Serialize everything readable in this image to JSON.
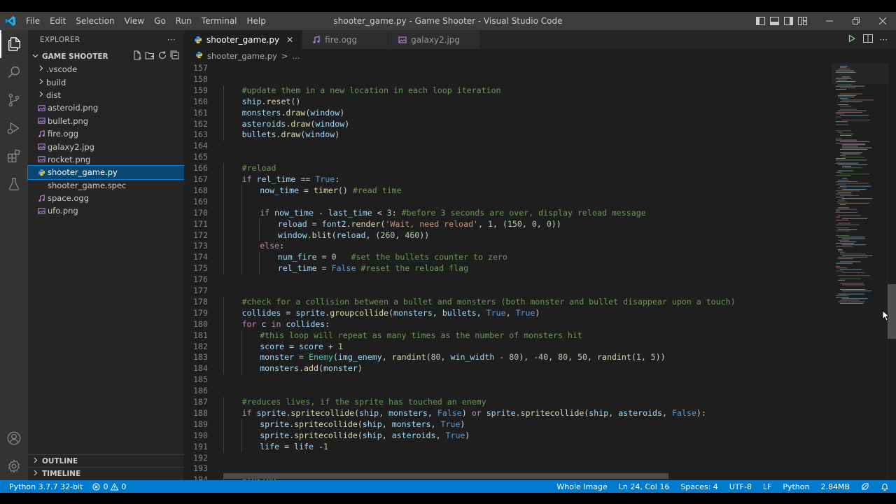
{
  "window": {
    "title": "shooter_game.py - Game Shooter - Visual Studio Code",
    "menu": [
      "File",
      "Edit",
      "Selection",
      "View",
      "Go",
      "Run",
      "Terminal",
      "Help"
    ]
  },
  "sidebar": {
    "header": "EXPLORER",
    "more": "···",
    "folder": "GAME SHOOTER",
    "items": [
      {
        "label": ".vscode",
        "type": "folder"
      },
      {
        "label": "build",
        "type": "folder"
      },
      {
        "label": "dist",
        "type": "folder"
      },
      {
        "label": "asteroid.png",
        "type": "image"
      },
      {
        "label": "bullet.png",
        "type": "image"
      },
      {
        "label": "fire.ogg",
        "type": "audio"
      },
      {
        "label": "galaxy2.jpg",
        "type": "image"
      },
      {
        "label": "rocket.png",
        "type": "image"
      },
      {
        "label": "shooter_game.py",
        "type": "python",
        "selected": true
      },
      {
        "label": "shooter_game.spec",
        "type": "spec"
      },
      {
        "label": "space.ogg",
        "type": "audio"
      },
      {
        "label": "ufo.png",
        "type": "image"
      }
    ],
    "outline": "OUTLINE",
    "timeline": "TIMELINE"
  },
  "tabs": [
    {
      "label": "shooter_game.py",
      "active": true,
      "type": "python"
    },
    {
      "label": "fire.ogg",
      "active": false,
      "type": "audio"
    },
    {
      "label": "galaxy2.jpg",
      "active": false,
      "type": "image"
    }
  ],
  "breadcrumb": {
    "file": "shooter_game.py",
    "sep": ">",
    "rest": "..."
  },
  "code": {
    "lines": [
      {
        "n": "157",
        "indent": 0,
        "tokens": []
      },
      {
        "n": "158",
        "indent": 0,
        "tokens": []
      },
      {
        "n": "159",
        "indent": 1,
        "tokens": [
          [
            "c-com",
            "#update them in a new location in each loop iteration"
          ]
        ]
      },
      {
        "n": "160",
        "indent": 1,
        "tokens": [
          [
            "c-var",
            "ship"
          ],
          [
            "",
            "."
          ],
          [
            "c-fn",
            "reset"
          ],
          [
            "",
            "()"
          ]
        ]
      },
      {
        "n": "161",
        "indent": 1,
        "tokens": [
          [
            "c-var",
            "monsters"
          ],
          [
            "",
            "."
          ],
          [
            "c-fn",
            "draw"
          ],
          [
            "",
            "("
          ],
          [
            "c-var",
            "window"
          ],
          [
            "",
            ")"
          ]
        ]
      },
      {
        "n": "162",
        "indent": 1,
        "tokens": [
          [
            "c-var",
            "asteroids"
          ],
          [
            "",
            "."
          ],
          [
            "c-fn",
            "draw"
          ],
          [
            "",
            "("
          ],
          [
            "c-var",
            "window"
          ],
          [
            "",
            ")"
          ]
        ]
      },
      {
        "n": "163",
        "indent": 1,
        "tokens": [
          [
            "c-var",
            "bullets"
          ],
          [
            "",
            "."
          ],
          [
            "c-fn",
            "draw"
          ],
          [
            "",
            "("
          ],
          [
            "c-var",
            "window"
          ],
          [
            "",
            ")"
          ]
        ]
      },
      {
        "n": "164",
        "indent": 0,
        "tokens": []
      },
      {
        "n": "165",
        "indent": 0,
        "tokens": []
      },
      {
        "n": "166",
        "indent": 1,
        "tokens": [
          [
            "c-com",
            "#reload"
          ]
        ]
      },
      {
        "n": "167",
        "indent": 1,
        "tokens": [
          [
            "c-kw",
            "if"
          ],
          [
            "",
            " "
          ],
          [
            "c-var",
            "rel_time"
          ],
          [
            "",
            " == "
          ],
          [
            "c-bool",
            "True"
          ],
          [
            "",
            ":"
          ]
        ]
      },
      {
        "n": "168",
        "indent": 2,
        "tokens": [
          [
            "c-var",
            "now_time"
          ],
          [
            "",
            " = "
          ],
          [
            "c-fn",
            "timer"
          ],
          [
            "",
            "() "
          ],
          [
            "c-com",
            "#read time"
          ]
        ]
      },
      {
        "n": "169",
        "indent": 0,
        "tokens": []
      },
      {
        "n": "170",
        "indent": 2,
        "tokens": [
          [
            "c-kw",
            "if"
          ],
          [
            "",
            " "
          ],
          [
            "c-var",
            "now_time"
          ],
          [
            "",
            " - "
          ],
          [
            "c-var",
            "last_time"
          ],
          [
            "",
            " < "
          ],
          [
            "c-num",
            "3"
          ],
          [
            "",
            ": "
          ],
          [
            "c-com",
            "#before 3 seconds are over, display reload message"
          ]
        ]
      },
      {
        "n": "171",
        "indent": 3,
        "tokens": [
          [
            "c-var",
            "reload"
          ],
          [
            "",
            " = "
          ],
          [
            "c-var",
            "font2"
          ],
          [
            "",
            "."
          ],
          [
            "c-fn",
            "render"
          ],
          [
            "",
            "("
          ],
          [
            "c-str",
            "'Wait, need reload'"
          ],
          [
            "",
            ", "
          ],
          [
            "c-num",
            "1"
          ],
          [
            "",
            ", ("
          ],
          [
            "c-num",
            "150"
          ],
          [
            "",
            ", "
          ],
          [
            "c-num",
            "0"
          ],
          [
            "",
            ", "
          ],
          [
            "c-num",
            "0"
          ],
          [
            "",
            "))"
          ]
        ]
      },
      {
        "n": "172",
        "indent": 3,
        "tokens": [
          [
            "c-var",
            "window"
          ],
          [
            "",
            "."
          ],
          [
            "c-fn",
            "blit"
          ],
          [
            "",
            "("
          ],
          [
            "c-var",
            "reload"
          ],
          [
            "",
            ", ("
          ],
          [
            "c-num",
            "260"
          ],
          [
            "",
            ", "
          ],
          [
            "c-num",
            "460"
          ],
          [
            "",
            "))"
          ]
        ]
      },
      {
        "n": "173",
        "indent": 2,
        "tokens": [
          [
            "c-kw",
            "else"
          ],
          [
            "",
            ":"
          ]
        ]
      },
      {
        "n": "174",
        "indent": 3,
        "tokens": [
          [
            "c-var",
            "num_fire"
          ],
          [
            "",
            " = "
          ],
          [
            "c-num",
            "0"
          ],
          [
            "",
            "   "
          ],
          [
            "c-com",
            "#set the bullets counter to zero"
          ]
        ]
      },
      {
        "n": "175",
        "indent": 3,
        "tokens": [
          [
            "c-var",
            "rel_time"
          ],
          [
            "",
            " = "
          ],
          [
            "c-bool",
            "False"
          ],
          [
            "",
            " "
          ],
          [
            "c-com",
            "#reset the reload flag"
          ]
        ]
      },
      {
        "n": "176",
        "indent": 0,
        "tokens": []
      },
      {
        "n": "177",
        "indent": 0,
        "tokens": []
      },
      {
        "n": "178",
        "indent": 1,
        "tokens": [
          [
            "c-com",
            "#check for a collision between a bullet and monsters (both monster and bullet disappear upon a touch)"
          ]
        ]
      },
      {
        "n": "179",
        "indent": 1,
        "tokens": [
          [
            "c-var",
            "collides"
          ],
          [
            "",
            " = "
          ],
          [
            "c-var",
            "sprite"
          ],
          [
            "",
            "."
          ],
          [
            "c-fn",
            "groupcollide"
          ],
          [
            "",
            "("
          ],
          [
            "c-var",
            "monsters"
          ],
          [
            "",
            ", "
          ],
          [
            "c-var",
            "bullets"
          ],
          [
            "",
            ", "
          ],
          [
            "c-bool",
            "True"
          ],
          [
            "",
            ", "
          ],
          [
            "c-bool",
            "True"
          ],
          [
            "",
            ")"
          ]
        ]
      },
      {
        "n": "180",
        "indent": 1,
        "tokens": [
          [
            "c-kw",
            "for"
          ],
          [
            "",
            " "
          ],
          [
            "c-var",
            "c"
          ],
          [
            "",
            " "
          ],
          [
            "c-kw",
            "in"
          ],
          [
            "",
            " "
          ],
          [
            "c-var",
            "collides"
          ],
          [
            "",
            ":"
          ]
        ]
      },
      {
        "n": "181",
        "indent": 2,
        "tokens": [
          [
            "c-com",
            "#this loop will repeat as many times as the number of monsters hit"
          ]
        ]
      },
      {
        "n": "182",
        "indent": 2,
        "tokens": [
          [
            "c-var",
            "score"
          ],
          [
            "",
            " = "
          ],
          [
            "c-var",
            "score"
          ],
          [
            "",
            " + "
          ],
          [
            "c-num",
            "1"
          ]
        ]
      },
      {
        "n": "183",
        "indent": 2,
        "tokens": [
          [
            "c-var",
            "monster"
          ],
          [
            "",
            " = "
          ],
          [
            "c-cls",
            "Enemy"
          ],
          [
            "",
            "("
          ],
          [
            "c-var",
            "img_enemy"
          ],
          [
            "",
            ", "
          ],
          [
            "c-fn",
            "randint"
          ],
          [
            "",
            "("
          ],
          [
            "c-num",
            "80"
          ],
          [
            "",
            ", "
          ],
          [
            "c-var",
            "win_width"
          ],
          [
            "",
            " - "
          ],
          [
            "c-num",
            "80"
          ],
          [
            "",
            "), -"
          ],
          [
            "c-num",
            "40"
          ],
          [
            "",
            ", "
          ],
          [
            "c-num",
            "80"
          ],
          [
            "",
            ", "
          ],
          [
            "c-num",
            "50"
          ],
          [
            "",
            ", "
          ],
          [
            "c-fn",
            "randint"
          ],
          [
            "",
            "("
          ],
          [
            "c-num",
            "1"
          ],
          [
            "",
            ", "
          ],
          [
            "c-num",
            "5"
          ],
          [
            "",
            "))"
          ]
        ]
      },
      {
        "n": "184",
        "indent": 2,
        "tokens": [
          [
            "c-var",
            "monsters"
          ],
          [
            "",
            "."
          ],
          [
            "c-fn",
            "add"
          ],
          [
            "",
            "("
          ],
          [
            "c-var",
            "monster"
          ],
          [
            "",
            ")"
          ]
        ]
      },
      {
        "n": "185",
        "indent": 0,
        "tokens": []
      },
      {
        "n": "186",
        "indent": 0,
        "tokens": []
      },
      {
        "n": "187",
        "indent": 1,
        "tokens": [
          [
            "c-com",
            "#reduces lives, if the sprite has touched an enemy"
          ]
        ]
      },
      {
        "n": "188",
        "indent": 1,
        "tokens": [
          [
            "c-kw",
            "if"
          ],
          [
            "",
            " "
          ],
          [
            "c-var",
            "sprite"
          ],
          [
            "",
            "."
          ],
          [
            "c-fn",
            "spritecollide"
          ],
          [
            "",
            "("
          ],
          [
            "c-var",
            "ship"
          ],
          [
            "",
            ", "
          ],
          [
            "c-var",
            "monsters"
          ],
          [
            "",
            ", "
          ],
          [
            "c-bool",
            "False"
          ],
          [
            "",
            ") "
          ],
          [
            "c-kw",
            "or"
          ],
          [
            "",
            " "
          ],
          [
            "c-var",
            "sprite"
          ],
          [
            "",
            "."
          ],
          [
            "c-fn",
            "spritecollide"
          ],
          [
            "",
            "("
          ],
          [
            "c-var",
            "ship"
          ],
          [
            "",
            ", "
          ],
          [
            "c-var",
            "asteroids"
          ],
          [
            "",
            ", "
          ],
          [
            "c-bool",
            "False"
          ],
          [
            "",
            "):"
          ]
        ]
      },
      {
        "n": "189",
        "indent": 2,
        "tokens": [
          [
            "c-var",
            "sprite"
          ],
          [
            "",
            "."
          ],
          [
            "c-fn",
            "spritecollide"
          ],
          [
            "",
            "("
          ],
          [
            "c-var",
            "ship"
          ],
          [
            "",
            ", "
          ],
          [
            "c-var",
            "monsters"
          ],
          [
            "",
            ", "
          ],
          [
            "c-bool",
            "True"
          ],
          [
            "",
            ")"
          ]
        ]
      },
      {
        "n": "190",
        "indent": 2,
        "tokens": [
          [
            "c-var",
            "sprite"
          ],
          [
            "",
            "."
          ],
          [
            "c-fn",
            "spritecollide"
          ],
          [
            "",
            "("
          ],
          [
            "c-var",
            "ship"
          ],
          [
            "",
            ", "
          ],
          [
            "c-var",
            "asteroids"
          ],
          [
            "",
            ", "
          ],
          [
            "c-bool",
            "True"
          ],
          [
            "",
            ")"
          ]
        ]
      },
      {
        "n": "191",
        "indent": 2,
        "tokens": [
          [
            "c-var",
            "life"
          ],
          [
            "",
            " = "
          ],
          [
            "c-var",
            "life"
          ],
          [
            "",
            " -"
          ],
          [
            "c-num",
            "1"
          ]
        ]
      },
      {
        "n": "192",
        "indent": 0,
        "tokens": []
      },
      {
        "n": "193",
        "indent": 0,
        "tokens": []
      },
      {
        "n": "194",
        "indent": 1,
        "tokens": [
          [
            "c-com",
            "#losing"
          ]
        ]
      }
    ]
  },
  "statusbar": {
    "python": "Python 3.7.7 32-bit",
    "errors": "0",
    "warnings": "0",
    "whole_image": "Whole Image",
    "position": "Ln 24, Col 16",
    "spaces": "Spaces: 4",
    "encoding": "UTF-8",
    "eol": "LF",
    "language": "Python",
    "size": "2.84MB"
  },
  "colors": {
    "accent": "#007acc",
    "editor_bg": "#1e1e1e",
    "sidebar_bg": "#252526",
    "selection": "#094771"
  }
}
